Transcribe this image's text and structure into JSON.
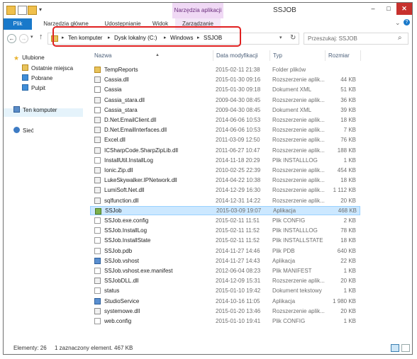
{
  "window": {
    "title": "SSJOB",
    "context_tab_header": "Narzędzia aplikacji",
    "minimize": "–",
    "maximize": "□",
    "close": "✕"
  },
  "ribbon": {
    "tabs": [
      {
        "label": "Plik"
      },
      {
        "label": "Narzędzia główne"
      },
      {
        "label": "Udostępnianie"
      },
      {
        "label": "Widok"
      },
      {
        "label": "Zarządzanie"
      }
    ]
  },
  "address": {
    "crumbs": [
      "Ten komputer",
      "Dysk lokalny (C:)",
      "Windows",
      "SSJOB"
    ]
  },
  "search": {
    "placeholder": "Przeszukaj: SSJOB"
  },
  "nav": {
    "favorites": "Ulubione",
    "items": [
      "Ostatnie miejsca",
      "Pobrane",
      "Pulpit"
    ],
    "computer": "Ten komputer",
    "network": "Sieć"
  },
  "columns": {
    "name": "Nazwa",
    "date": "Data modyfikacji",
    "type": "Typ",
    "size": "Rozmiar"
  },
  "files": [
    {
      "name": "TempReports",
      "date": "2015-02-11 21:38",
      "type": "Folder plików",
      "size": "",
      "icon": "folder"
    },
    {
      "name": "Cassia.dll",
      "date": "2015-01-30 09:16",
      "type": "Rozszerzenie aplik...",
      "size": "44 KB",
      "icon": "dll"
    },
    {
      "name": "Cassia",
      "date": "2015-01-30 09:18",
      "type": "Dokument XML",
      "size": "51 KB",
      "icon": "xml"
    },
    {
      "name": "Cassia_stara.dll",
      "date": "2009-04-30 08:45",
      "type": "Rozszerzenie aplik...",
      "size": "36 KB",
      "icon": "dll"
    },
    {
      "name": "Cassia_stara",
      "date": "2009-04-30 08:45",
      "type": "Dokument XML",
      "size": "39 KB",
      "icon": "xml"
    },
    {
      "name": "D.Net.EmailClient.dll",
      "date": "2014-06-06 10:53",
      "type": "Rozszerzenie aplik...",
      "size": "18 KB",
      "icon": "dll"
    },
    {
      "name": "D.Net.EmailInterfaces.dll",
      "date": "2014-06-06 10:53",
      "type": "Rozszerzenie aplik...",
      "size": "7 KB",
      "icon": "dll"
    },
    {
      "name": "Excel.dll",
      "date": "2011-03-09 12:50",
      "type": "Rozszerzenie aplik...",
      "size": "76 KB",
      "icon": "dll"
    },
    {
      "name": "ICSharpCode.SharpZipLib.dll",
      "date": "2011-06-27 10:47",
      "type": "Rozszerzenie aplik...",
      "size": "188 KB",
      "icon": "dll"
    },
    {
      "name": "InstallUtil.InstallLog",
      "date": "2014-11-18 20:29",
      "type": "Plik INSTALLLOG",
      "size": "1 KB",
      "icon": "file"
    },
    {
      "name": "Ionic.Zip.dll",
      "date": "2010-02-25 22:39",
      "type": "Rozszerzenie aplik...",
      "size": "454 KB",
      "icon": "dll"
    },
    {
      "name": "LukeSkywalker.IPNetwork.dll",
      "date": "2014-04-22 10:38",
      "type": "Rozszerzenie aplik...",
      "size": "18 KB",
      "icon": "dll"
    },
    {
      "name": "LumiSoft.Net.dll",
      "date": "2014-12-29 16:30",
      "type": "Rozszerzenie aplik...",
      "size": "1 112 KB",
      "icon": "dll"
    },
    {
      "name": "sqlfunction.dll",
      "date": "2014-12-31 14:22",
      "type": "Rozszerzenie aplik...",
      "size": "20 KB",
      "icon": "dll"
    },
    {
      "name": "SSJob",
      "date": "2015-03-09 19:07",
      "type": "Aplikacja",
      "size": "468 KB",
      "icon": "ssjob",
      "selected": true
    },
    {
      "name": "SSJob.exe.config",
      "date": "2015-02-11 11:51",
      "type": "Plik CONFIG",
      "size": "2 KB",
      "icon": "file"
    },
    {
      "name": "SSJob.InstallLog",
      "date": "2015-02-11 11:52",
      "type": "Plik INSTALLLOG",
      "size": "78 KB",
      "icon": "file"
    },
    {
      "name": "SSJob.InstallState",
      "date": "2015-02-11 11:52",
      "type": "Plik INSTALLSTATE",
      "size": "18 KB",
      "icon": "file"
    },
    {
      "name": "SSJob.pdb",
      "date": "2014-11-27 14:46",
      "type": "Plik PDB",
      "size": "640 KB",
      "icon": "file"
    },
    {
      "name": "SSJob.vshost",
      "date": "2014-11-27 14:43",
      "type": "Aplikacja",
      "size": "22 KB",
      "icon": "app"
    },
    {
      "name": "SSJob.vshost.exe.manifest",
      "date": "2012-06-04 08:23",
      "type": "Plik MANIFEST",
      "size": "1 KB",
      "icon": "file"
    },
    {
      "name": "SSJobDLL.dll",
      "date": "2014-12-09 15:31",
      "type": "Rozszerzenie aplik...",
      "size": "20 KB",
      "icon": "dll"
    },
    {
      "name": "status",
      "date": "2015-01-10 19:42",
      "type": "Dokument tekstowy",
      "size": "1 KB",
      "icon": "file"
    },
    {
      "name": "StudioService",
      "date": "2014-10-16 11:05",
      "type": "Aplikacja",
      "size": "1 980 KB",
      "icon": "app"
    },
    {
      "name": "systemowe.dll",
      "date": "2015-01-20 13:46",
      "type": "Rozszerzenie aplik...",
      "size": "20 KB",
      "icon": "dll"
    },
    {
      "name": "web.config",
      "date": "2015-01-10 19:41",
      "type": "Plik CONFIG",
      "size": "1 KB",
      "icon": "file"
    }
  ],
  "status": {
    "count": "Elementy: 26",
    "selection": "1 zaznaczony element. 467 KB"
  }
}
